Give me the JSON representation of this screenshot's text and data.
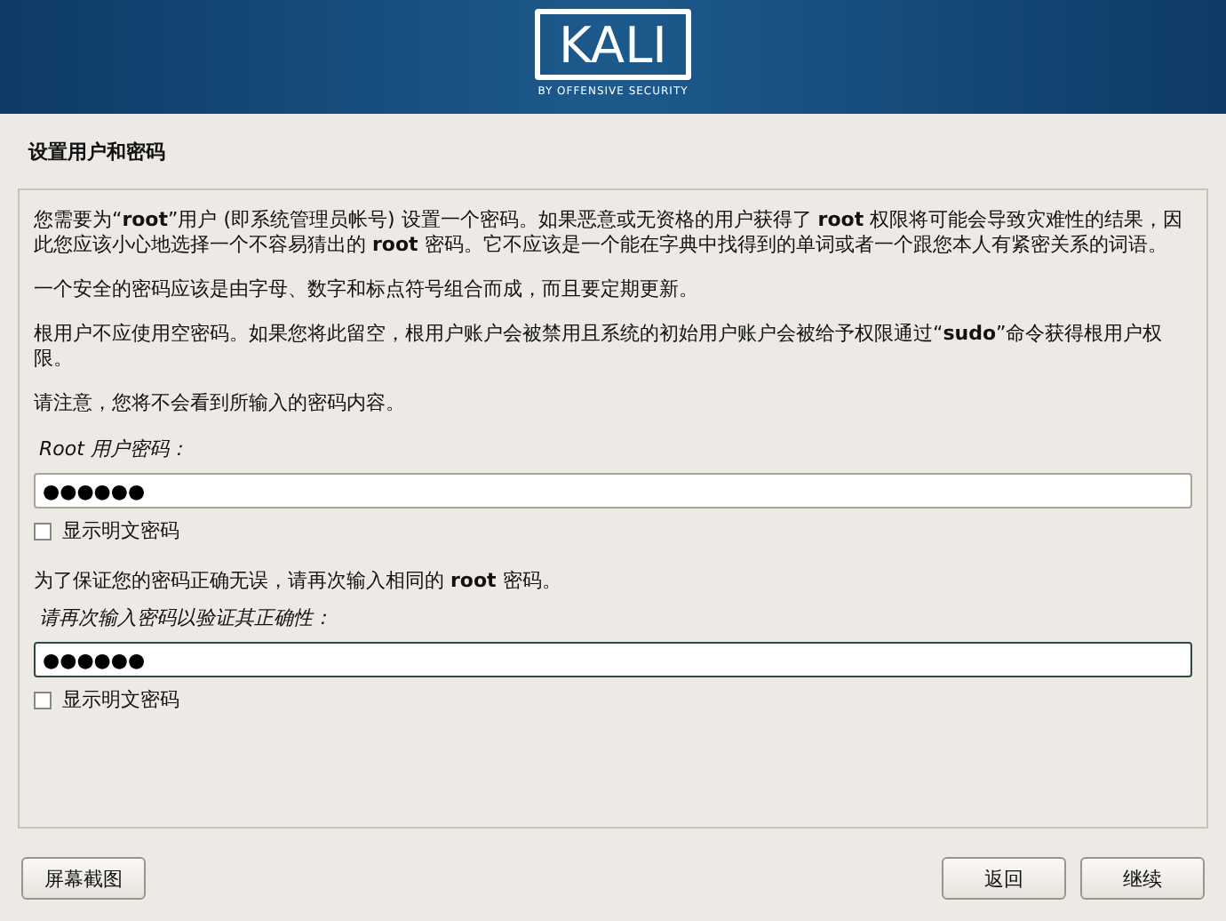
{
  "header": {
    "logo": "KALI",
    "tagline": "BY OFFENSIVE SECURITY"
  },
  "page_title": "设置用户和密码",
  "paragraphs": [
    "您需要为“**root**”用户 (即系统管理员帐号) 设置一个密码。如果恶意或无资格的用户获得了 **root** 权限将可能会导致灾难性的结果，因此您应该小心地选择一个不容易猜出的 **root** 密码。它不应该是一个能在字典中找得到的单词或者一个跟您本人有紧密关系的词语。",
    "一个安全的密码应该是由字母、数字和标点符号组合而成，而且要定期更新。",
    "根用户不应使用空密码。如果您将此留空，根用户账户会被禁用且系统的初始用户账户会被给予权限通过“**sudo**”命令获得根用户权限。",
    "请注意，您将不会看到所输入的密码内容。"
  ],
  "fields": [
    {
      "label": "Root 用户密码：",
      "value": "●●●●●●",
      "focused": false,
      "show_password": {
        "label": "显示明文密码",
        "checked": false
      }
    },
    {
      "intro": "为了保证您的密码正确无误，请再次输入相同的 **root** 密码。",
      "label": "请再次输入密码以验证其正确性：",
      "value": "●●●●●●",
      "focused": true,
      "show_password": {
        "label": "显示明文密码",
        "checked": false
      }
    }
  ],
  "buttons": {
    "left": [
      "屏幕截图"
    ],
    "right": [
      "返回",
      "继续"
    ]
  }
}
